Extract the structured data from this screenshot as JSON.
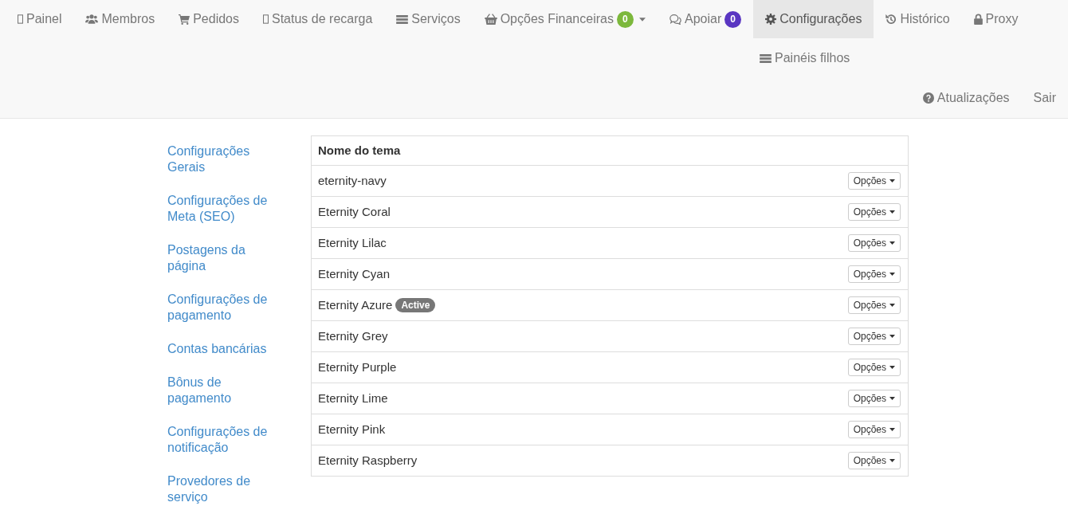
{
  "navbar": {
    "items": [
      {
        "label": "Painel",
        "selected": false,
        "has_dropdown": false
      },
      {
        "label": "Membros",
        "selected": false,
        "has_dropdown": false
      },
      {
        "label": "Pedidos",
        "selected": false,
        "has_dropdown": false
      },
      {
        "label": "Status de recarga",
        "selected": false,
        "has_dropdown": false
      },
      {
        "label": "Serviços",
        "selected": false,
        "has_dropdown": false
      },
      {
        "label": "Opções Financeiras",
        "selected": false,
        "has_dropdown": true,
        "badge": {
          "text": "0",
          "color": "#7cb83c"
        }
      },
      {
        "label": "Apoiar",
        "selected": false,
        "has_dropdown": false,
        "badge": {
          "text": "0",
          "color": "#5a36c2"
        }
      },
      {
        "label": "Configurações",
        "selected": true,
        "has_dropdown": false
      },
      {
        "label": "Histórico",
        "selected": false,
        "has_dropdown": false
      },
      {
        "label": "Proxy",
        "selected": false,
        "has_dropdown": false
      }
    ],
    "sub_items": [
      {
        "label": "Painéis filhos",
        "selected": false
      }
    ],
    "right_items": [
      {
        "label": "Atualizações",
        "selected": false
      },
      {
        "label": "Sair",
        "selected": false
      }
    ]
  },
  "sidebar": {
    "items": [
      {
        "label": "Configurações Gerais"
      },
      {
        "label": "Configurações de Meta (SEO)"
      },
      {
        "label": "Postagens da página"
      },
      {
        "label": "Configurações de pagamento"
      },
      {
        "label": "Contas bancárias"
      },
      {
        "label": "Bônus de pagamento"
      },
      {
        "label": "Configurações de notificação"
      },
      {
        "label": "Provedores de serviço"
      }
    ]
  },
  "table": {
    "columns": [
      "Nome do tema"
    ],
    "rows": [
      {
        "name": "eternity-navy",
        "button": "Opções"
      },
      {
        "name": "Eternity Coral",
        "button": "Opções"
      },
      {
        "name": "Eternity Lilac",
        "button": "Opções"
      },
      {
        "name": "Eternity Cyan",
        "button": "Opções"
      },
      {
        "name": "Eternity Azure",
        "badge": "Active",
        "button": "Opções"
      },
      {
        "name": "Eternity Grey",
        "button": "Opções"
      },
      {
        "name": "Eternity Purple",
        "button": "Opções"
      },
      {
        "name": "Eternity Lime",
        "button": "Opções"
      },
      {
        "name": "Eternity Pink",
        "button": "Opções"
      },
      {
        "name": "Eternity Raspberry",
        "button": "Opções"
      }
    ]
  }
}
